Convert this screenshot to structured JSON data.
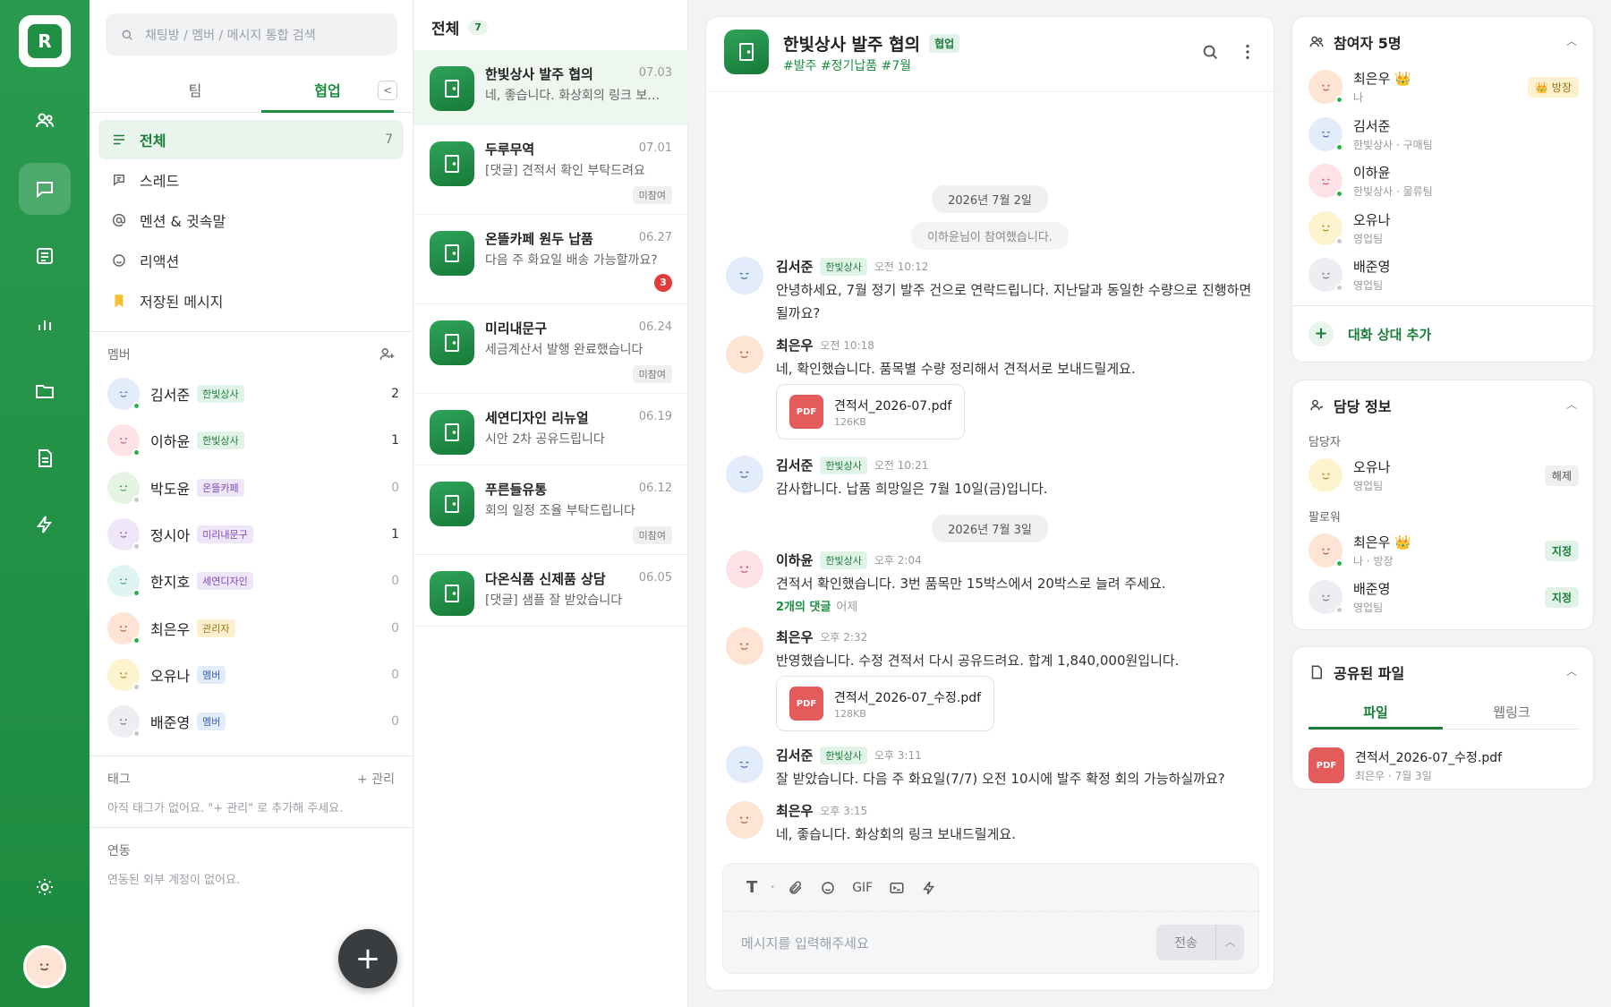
{
  "rail": {
    "logo_letter": "R",
    "items": [
      {
        "icon": "users-icon"
      },
      {
        "icon": "chat-icon",
        "active": true
      },
      {
        "icon": "board-icon"
      },
      {
        "icon": "chart-icon"
      },
      {
        "icon": "folder-icon"
      },
      {
        "icon": "document-icon"
      },
      {
        "icon": "bolt-icon"
      }
    ],
    "settings_icon": "sun-icon"
  },
  "nav": {
    "search_placeholder": "채팅방 / 멤버 / 메시지 통합 검색",
    "tabs": [
      {
        "label": "팀"
      },
      {
        "label": "협업",
        "active": true
      }
    ],
    "collapse_glyph": "<",
    "menu": [
      {
        "label": "전체",
        "count": "7",
        "icon": "list-icon",
        "active": true
      },
      {
        "label": "스레드",
        "count": "",
        "icon": "thread-icon"
      },
      {
        "label": "멘션 & 귓속말",
        "count": "",
        "icon": "at-icon"
      },
      {
        "label": "리액션",
        "count": "",
        "icon": "smile-icon"
      },
      {
        "label": "저장된 메시지",
        "count": "",
        "icon": "bookmark-icon"
      }
    ],
    "members_title": "멤버",
    "members": [
      {
        "name": "김서준",
        "badge": "한빛상사",
        "count": "2",
        "online": true
      },
      {
        "name": "이하윤",
        "badge": "한빛상사",
        "count": "1",
        "online": true
      },
      {
        "name": "박도윤",
        "badge": "온뜰카페",
        "count": "0",
        "online": false
      },
      {
        "name": "정시아",
        "badge": "미리내문구",
        "count": "1",
        "online": false
      },
      {
        "name": "한지호",
        "badge": "세연디자인",
        "count": "0",
        "online": true
      },
      {
        "name": "최은우",
        "badge": "관리자",
        "count": "0",
        "online": true
      },
      {
        "name": "오유나",
        "badge": "멤버",
        "count": "0",
        "online": false
      },
      {
        "name": "배준영",
        "badge": "멤버",
        "count": "0",
        "online": false
      }
    ],
    "tags_title": "태그",
    "tags_manage": "+ 관리",
    "tags_empty": "아직 태그가 없어요. \"+ 관리\" 로 추가해 주세요.",
    "linked_title": "연동",
    "linked_empty": "연동된 외부 계정이 없어요.",
    "fab_glyph": "+"
  },
  "channels": {
    "title": "전체",
    "count": "7",
    "items": [
      {
        "name": "한빛상사 발주 협의",
        "date": "07.03",
        "preview": "네, 좋습니다. 화상회의 링크 보내드릴게요.",
        "tag": "",
        "unread": "",
        "active": true
      },
      {
        "name": "두루무역",
        "date": "07.01",
        "preview": "[댓글] 견적서 확인 부탁드려요",
        "tag": "미참여",
        "unread": ""
      },
      {
        "name": "온뜰카페 원두 납품",
        "date": "06.27",
        "preview": "다음 주 화요일 배송 가능할까요?",
        "tag": "",
        "unread": "3"
      },
      {
        "name": "미리내문구",
        "date": "06.24",
        "preview": "세금계산서 발행 완료했습니다",
        "tag": "미참여",
        "unread": ""
      },
      {
        "name": "세연디자인 리뉴얼",
        "date": "06.19",
        "preview": "시안 2차 공유드립니다",
        "tag": "",
        "unread": ""
      },
      {
        "name": "푸른들유통",
        "date": "06.12",
        "preview": "회의 일정 조율 부탁드립니다",
        "tag": "미참여",
        "unread": ""
      },
      {
        "name": "다온식품 신제품 상담",
        "date": "06.05",
        "preview": "[댓글] 샘플 잘 받았습니다",
        "tag": "",
        "unread": ""
      }
    ]
  },
  "chat": {
    "title": "한빛상사 발주 협의",
    "badge": "협업",
    "hashtags": "#발주 #정기납품 #7월",
    "date1": "2026년 7월 2일",
    "system": "이하윤님이 참여했습니다.",
    "date2": "2026년 7월 3일",
    "messages": [
      {
        "name": "김서준",
        "badge": "한빛상사",
        "time": "오전 10:12",
        "text": "안녕하세요, 7월 정기 발주 건으로 연락드립니다. 지난달과 동일한 수량으로 진행하면 될까요?"
      },
      {
        "name": "최은우",
        "badge": "",
        "time": "오전 10:18",
        "text": "네, 확인했습니다. 품목별 수량 정리해서 견적서로 보내드릴게요.",
        "file": {
          "name": "견적서_2026-07.pdf",
          "size": "126KB"
        }
      },
      {
        "name": "김서준",
        "badge": "한빛상사",
        "time": "오전 10:21",
        "text": "감사합니다. 납품 희망일은 7월 10일(금)입니다."
      },
      {
        "name": "이하윤",
        "badge": "한빛상사",
        "time": "오후 2:04",
        "text": "견적서 확인했습니다. 3번 품목만 15박스에서 20박스로 늘려 주세요.",
        "reply": "2개의 댓글",
        "reply_time": "어제"
      },
      {
        "name": "최은우",
        "badge": "",
        "time": "오후 2:32",
        "text": "반영했습니다. 수정 견적서 다시 공유드려요. 합계 1,840,000원입니다.",
        "file": {
          "name": "견적서_2026-07_수정.pdf",
          "size": "128KB"
        }
      },
      {
        "name": "김서준",
        "badge": "한빛상사",
        "time": "오후 3:11",
        "text": "잘 받았습니다. 다음 주 화요일(7/7) 오전 10시에 발주 확정 회의 가능하실까요?"
      },
      {
        "name": "최은우",
        "badge": "",
        "time": "오후 3:15",
        "text": "네, 좋습니다. 화상회의 링크 보내드릴게요."
      }
    ],
    "pdf_label": "PDF",
    "composer": {
      "placeholder": "메시지를 입력해주세요",
      "send": "전송",
      "text_tool": "T",
      "gif_tool": "GIF"
    }
  },
  "participants": {
    "title": "참여자 5명",
    "list": [
      {
        "name": "최은우 👑",
        "sub": "나",
        "action": "👑 방장",
        "online": true
      },
      {
        "name": "김서준",
        "sub": "한빛상사 · 구매팀",
        "action": "",
        "online": true
      },
      {
        "name": "이하윤",
        "sub": "한빛상사 · 물류팀",
        "action": "",
        "online": true
      },
      {
        "name": "오유나",
        "sub": "영업팀",
        "action": "",
        "online": false
      },
      {
        "name": "배준영",
        "sub": "영업팀",
        "action": "",
        "online": false
      }
    ],
    "add_label": "대화 상대 추가"
  },
  "assignee": {
    "title": "담당 정보",
    "owner_title": "담당자",
    "owner": {
      "name": "오유나",
      "sub": "영업팀",
      "action": "해제"
    },
    "followers_title": "팔로워",
    "followers": [
      {
        "name": "최은우 👑",
        "sub": "나 · 방장",
        "action": "지정",
        "online": true
      },
      {
        "name": "배준영",
        "sub": "영업팀",
        "action": "지정",
        "online": false
      }
    ]
  },
  "shared": {
    "title": "공유된 파일",
    "tabs": [
      {
        "label": "파일",
        "active": true
      },
      {
        "label": "웹링크"
      }
    ],
    "file": {
      "name": "견적서_2026-07_수정.pdf",
      "meta": "최은우 · 7월 3일"
    }
  },
  "colors": {
    "brand": "#1f8f43",
    "online": "#2bb24c",
    "offline": "#c5c8cc",
    "unread": "#e23b3b"
  }
}
